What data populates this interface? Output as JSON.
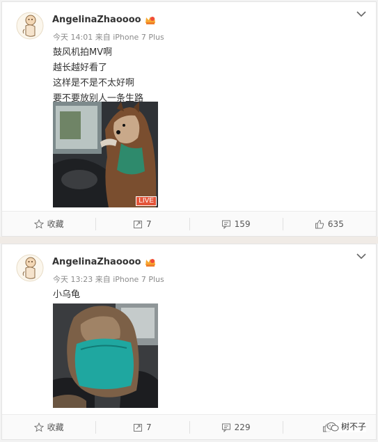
{
  "posts": [
    {
      "user": "AngelinaZhaoooo",
      "time": "今天 14:01",
      "source": "来自 iPhone 7 Plus",
      "lines": [
        "鼓风机拍MV啊",
        "越长越好看了",
        "这样是不是不太好啊",
        "要不要放别人一条生路"
      ],
      "badge": "LIVE",
      "actions": {
        "favorite": "收藏",
        "repost": "7",
        "comment": "159",
        "like": "635"
      }
    },
    {
      "user": "AngelinaZhaoooo",
      "time": "今天 13:23",
      "source": "来自 iPhone 7 Plus",
      "lines": [
        "小乌龟"
      ],
      "actions": {
        "favorite": "收藏",
        "repost": "7",
        "comment": "229",
        "like": ""
      }
    }
  ],
  "watermark": "树不子",
  "icons": {
    "avatar": "cartoon-baby-avatar",
    "crown": "vip-crown-icon",
    "menu": "chevron-down-icon",
    "favorite": "star-icon",
    "repost": "repost-icon",
    "comment": "comment-icon",
    "like": "thumbs-up-icon",
    "watermark": "wechat-icon"
  },
  "colors": {
    "accent": "#e4553a",
    "meta": "#8a8a8a",
    "divider": "#e4e4e4"
  }
}
